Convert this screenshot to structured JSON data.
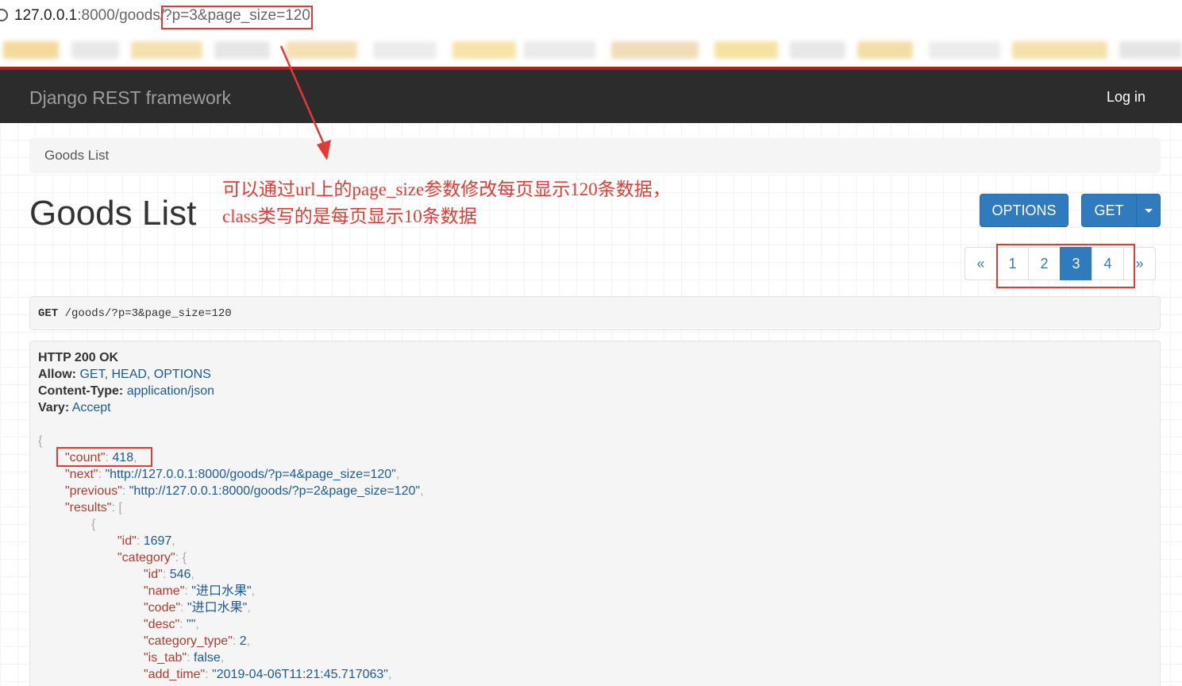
{
  "browser": {
    "url_host": "127.0.0.1",
    "url_port_path": ":8000/goods/",
    "url_query": "?p=3&page_size=120"
  },
  "navbar": {
    "brand": "Django REST framework",
    "login": "Log in"
  },
  "breadcrumb": {
    "item": "Goods List"
  },
  "page": {
    "title": "Goods List"
  },
  "annotation": {
    "line1": "可以通过url上的page_size参数修改每页显示120条数据，",
    "line2": "class类写的是每页显示10条数据"
  },
  "buttons": {
    "options": "OPTIONS",
    "get": "GET"
  },
  "pagination": {
    "prev": "«",
    "pages": [
      "1",
      "2",
      "3",
      "4"
    ],
    "active": "3",
    "next": "»"
  },
  "request": {
    "method": "GET",
    "path": "/goods/?p=3&page_size=120"
  },
  "response": {
    "status": "HTTP 200 OK",
    "headers": [
      {
        "name": "Allow:",
        "value": "GET, HEAD, OPTIONS"
      },
      {
        "name": "Content-Type:",
        "value": "application/json"
      },
      {
        "name": "Vary:",
        "value": "Accept"
      }
    ],
    "body": {
      "count_key": "\"count\"",
      "count_val": "418",
      "next_key": "\"next\"",
      "next_val": "\"http://127.0.0.1:8000/goods/?p=4&page_size=120\"",
      "previous_key": "\"previous\"",
      "previous_val": "\"http://127.0.0.1:8000/goods/?p=2&page_size=120\"",
      "results_key": "\"results\"",
      "id_key": "\"id\"",
      "id_val": "1697",
      "category_key": "\"category\"",
      "cat_id_key": "\"id\"",
      "cat_id_val": "546",
      "cat_name_key": "\"name\"",
      "cat_name_val": "\"进口水果\"",
      "cat_code_key": "\"code\"",
      "cat_code_val": "\"进口水果\"",
      "cat_desc_key": "\"desc\"",
      "cat_desc_val": "\"\"",
      "cat_type_key": "\"category_type\"",
      "cat_type_val": "2",
      "cat_istab_key": "\"is_tab\"",
      "cat_istab_val": "false",
      "cat_addtime_key": "\"add_time\"",
      "cat_addtime_val": "\"2019-04-06T11:21:45.717063\""
    }
  },
  "colors": {
    "navbar_bg": "#2c2c2c",
    "primary": "#2f7bbd",
    "annotation_red": "#e53935",
    "json_key": "#ae3b2d",
    "json_value": "#1a5a98"
  }
}
